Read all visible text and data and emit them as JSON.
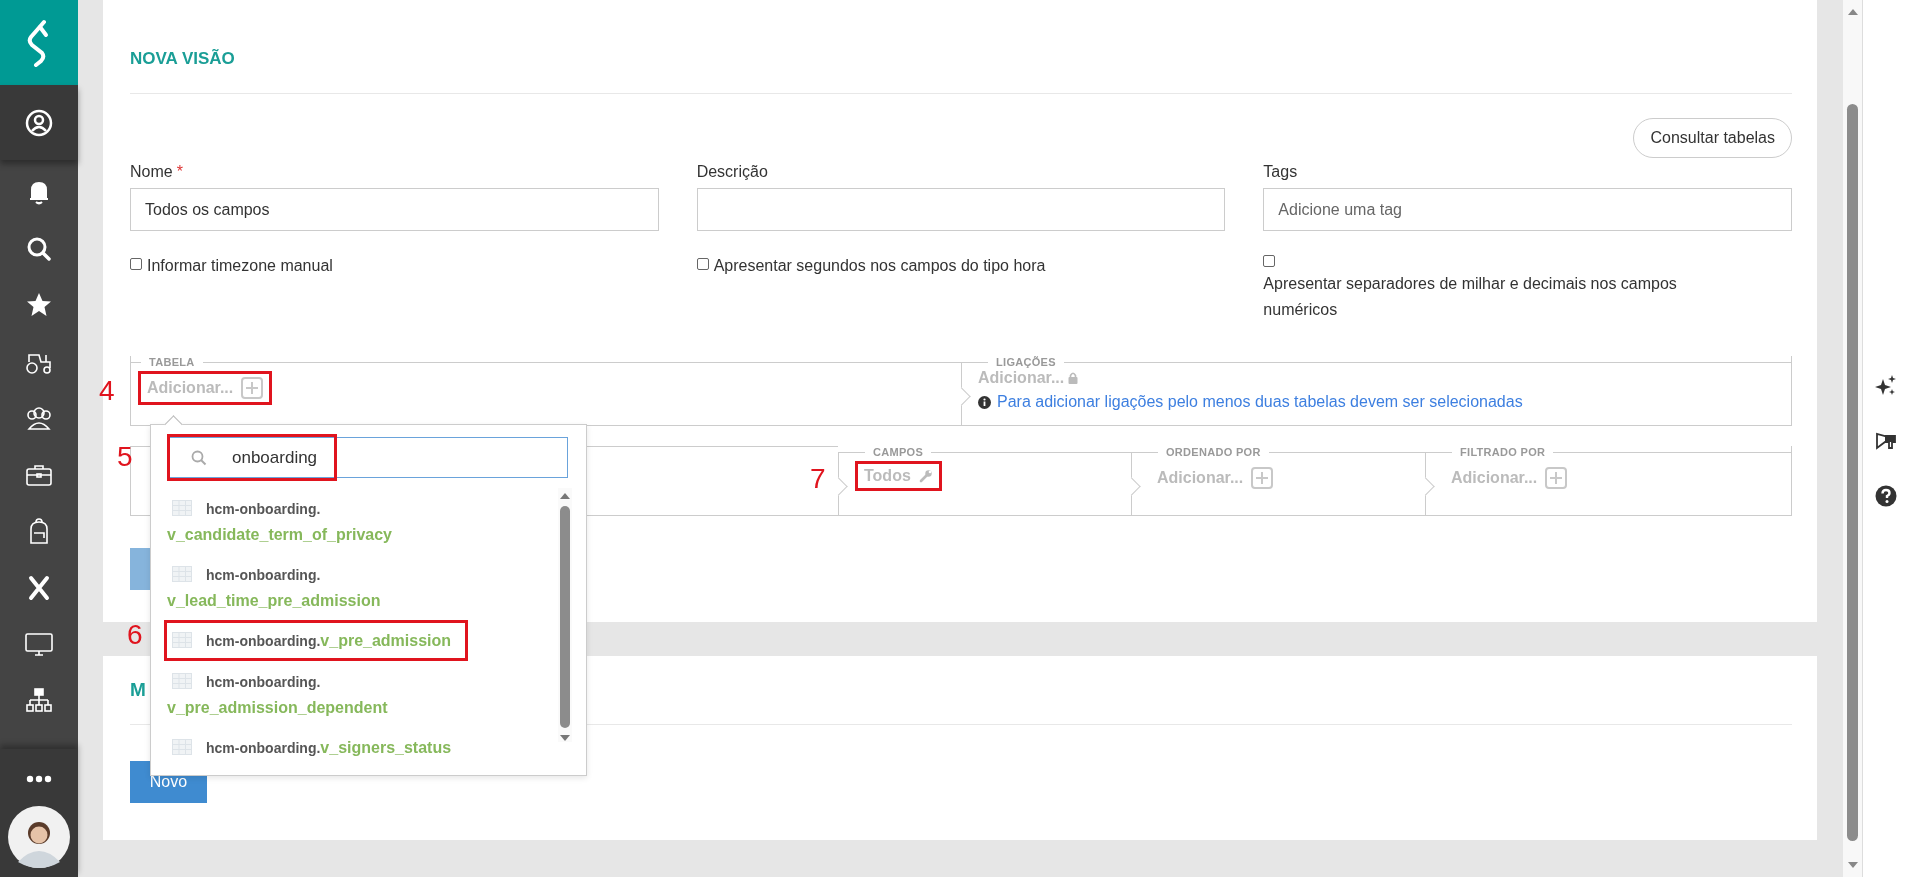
{
  "form": {
    "title": "NOVA VISÃO",
    "consult_button": "Consultar tabelas",
    "fields": [
      {
        "label": "Nome",
        "required_mark": "*",
        "value": "Todos os campos"
      },
      {
        "label": "Descrição"
      },
      {
        "label": "Tags",
        "placeholder": "Adicione uma tag"
      }
    ],
    "checkboxes": [
      {
        "label": "Informar timezone manual",
        "checked": false,
        "kind": "inline"
      },
      {
        "label": "Apresentar segundos nos campos do tipo hora",
        "checked": false,
        "kind": "inline"
      },
      {
        "label": "Apresentar separadores de milhar e decimais nos campos numéricos",
        "checked": false,
        "kind": "below"
      }
    ],
    "tabela": {
      "legend": "TABELA",
      "add_label": "Adicionar...",
      "annotation": "4"
    },
    "ligacoes": {
      "legend": "LIGAÇÕES",
      "add_label": "Adicionar...",
      "locked": true,
      "info": "Para adicionar ligações pelo menos duas tabelas devem ser selecionadas"
    },
    "query_row": [
      {
        "kind": "blank"
      },
      {
        "kind": "value",
        "legend": "CAMPOS",
        "value": "Todos",
        "annotation": "7"
      },
      {
        "kind": "add",
        "legend": "ORDENADO POR",
        "add_label": "Adicionar..."
      },
      {
        "kind": "add",
        "legend": "FILTRADO POR",
        "add_label": "Adicionar..."
      }
    ]
  },
  "dropdown": {
    "search": {
      "value": "onboarding",
      "annotation": "5"
    },
    "items": [
      {
        "schema": "hcm-onboarding.",
        "name": "v_candidate_term_of_privacy"
      },
      {
        "schema": "hcm-onboarding.",
        "name": "v_lead_time_pre_admission"
      },
      {
        "schema": "hcm-onboarding.",
        "name": "v_pre_admission",
        "annotation": "6"
      },
      {
        "schema": "hcm-onboarding.",
        "name": "v_pre_admission_dependent"
      },
      {
        "schema": "hcm-onboarding.",
        "name": "v_signers_status"
      }
    ]
  },
  "second_card": {
    "title": "M",
    "new_button": "Novo"
  }
}
